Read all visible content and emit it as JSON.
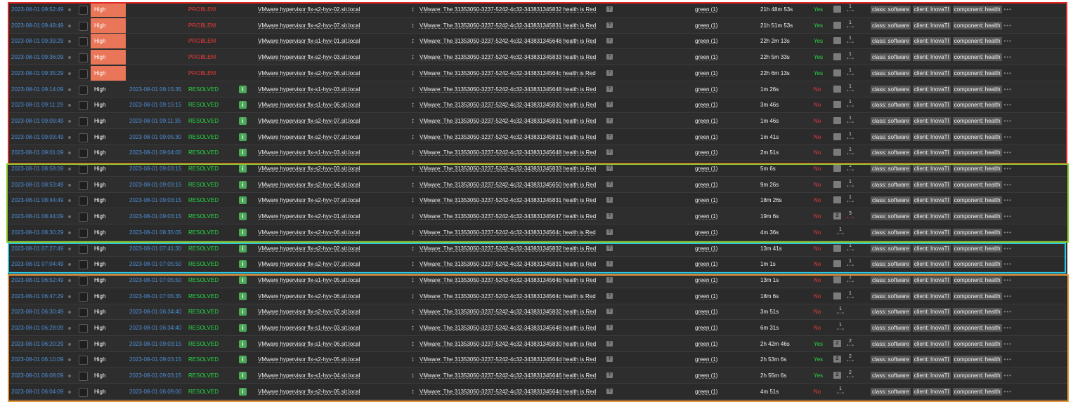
{
  "colors": {
    "accent_red": "#e32624",
    "accent_green": "#8ecb2f",
    "accent_cyan": "#2ec5df",
    "accent_orange": "#e8963c",
    "status_problem": "#e83b3b",
    "status_resolved": "#28d645",
    "severity_high": "#e97659",
    "link_blue": "#4f8fd6"
  },
  "tag_more": "•••",
  "rows": [
    {
      "time": "2023-08-01 09:52:49",
      "severity": "High",
      "sev_highlight": true,
      "recovery_time": "",
      "status": "PROBLEM",
      "status_type": "problem",
      "show_info": false,
      "host": "VMware hypervisor flx-s2-hyv-02.sit.local",
      "problem": "VMware: The 31353050-3237-5242-4c32-343831345832 health is Red",
      "op_data": "green (1)",
      "duration": "21h 48m 53s",
      "ack": "Yes",
      "msg_count": "",
      "actions_count": "1",
      "actions_red": false,
      "tags": [
        "class: software",
        "client: InovaTI",
        "component: health"
      ]
    },
    {
      "time": "2023-08-01 09:49:49",
      "severity": "High",
      "sev_highlight": true,
      "recovery_time": "",
      "status": "PROBLEM",
      "status_type": "problem",
      "show_info": false,
      "host": "VMware hypervisor flx-s2-hyv-07.sit.local",
      "problem": "VMware: The 31353050-3237-5242-4c32-343831345831 health is Red",
      "op_data": "green (1)",
      "duration": "21h 51m 53s",
      "ack": "Yes",
      "msg_count": "",
      "actions_count": "1",
      "actions_red": false,
      "tags": [
        "class: software",
        "client: InovaTI",
        "component: health"
      ]
    },
    {
      "time": "2023-08-01 09:39:29",
      "severity": "High",
      "sev_highlight": true,
      "recovery_time": "",
      "status": "PROBLEM",
      "status_type": "problem",
      "show_info": false,
      "host": "VMware hypervisor flx-s1-hyv-01.sit.local",
      "problem": "VMware: The 31353050-3237-5242-4c32-343831345648 health is Red",
      "op_data": "green (1)",
      "duration": "22h 2m 13s",
      "ack": "Yes",
      "msg_count": "",
      "actions_count": "1",
      "actions_red": false,
      "tags": [
        "class: software",
        "client: InovaTI",
        "component: health"
      ]
    },
    {
      "time": "2023-08-01 09:36:09",
      "severity": "High",
      "sev_highlight": true,
      "recovery_time": "",
      "status": "PROBLEM",
      "status_type": "problem",
      "show_info": false,
      "host": "VMware hypervisor flx-s2-hyv-03.sit.local",
      "problem": "VMware: The 31353050-3237-5242-4c32-343831345833 health is Red",
      "op_data": "green (1)",
      "duration": "22h 5m 33s",
      "ack": "Yes",
      "msg_count": "",
      "actions_count": "1",
      "actions_red": false,
      "tags": [
        "class: software",
        "client: InovaTI",
        "component: health"
      ]
    },
    {
      "time": "2023-08-01 09:35:29",
      "severity": "High",
      "sev_highlight": true,
      "recovery_time": "",
      "status": "PROBLEM",
      "status_type": "problem",
      "show_info": false,
      "host": "VMware hypervisor flx-s2-hyv-06.sit.local",
      "problem": "VMware: The 31353050-3237-5242-4c32-34383134564c health is Red",
      "op_data": "green (1)",
      "duration": "22h 6m 13s",
      "ack": "Yes",
      "msg_count": "",
      "actions_count": "1",
      "actions_red": false,
      "tags": [
        "class: software",
        "client: InovaTI",
        "component: health"
      ]
    },
    {
      "time": "2023-08-01 09:14:09",
      "severity": "High",
      "sev_highlight": false,
      "recovery_time": "2023-08-01 09:15:35",
      "status": "RESOLVED",
      "status_type": "resolved",
      "show_info": true,
      "host": "VMware hypervisor flx-s1-hyv-03.sit.local",
      "problem": "VMware: The 31353050-3237-5242-4c32-343831345648 health is Red",
      "op_data": "green (1)",
      "duration": "1m 26s",
      "ack": "No",
      "msg_count": "",
      "actions_count": "1",
      "actions_red": false,
      "tags": [
        "class: software",
        "client: InovaTI",
        "component: health"
      ]
    },
    {
      "time": "2023-08-01 09:11:29",
      "severity": "High",
      "sev_highlight": false,
      "recovery_time": "2023-08-01 09:15:15",
      "status": "RESOLVED",
      "status_type": "resolved",
      "show_info": true,
      "host": "VMware hypervisor flx-s1-hyv-06.sit.local",
      "problem": "VMware: The 31353050-3237-5242-4c32-343831345830 health is Red",
      "op_data": "green (1)",
      "duration": "3m 46s",
      "ack": "No",
      "msg_count": "",
      "actions_count": "1",
      "actions_red": false,
      "tags": [
        "class: software",
        "client: InovaTI",
        "component: health"
      ]
    },
    {
      "time": "2023-08-01 09:09:49",
      "severity": "High",
      "sev_highlight": false,
      "recovery_time": "2023-08-01 09:11:35",
      "status": "RESOLVED",
      "status_type": "resolved",
      "show_info": true,
      "host": "VMware hypervisor flx-s2-hyv-07.sit.local",
      "problem": "VMware: The 31353050-3237-5242-4c32-343831345831 health is Red",
      "op_data": "green (1)",
      "duration": "1m 46s",
      "ack": "No",
      "msg_count": "",
      "actions_count": "1",
      "actions_red": false,
      "tags": [
        "class: software",
        "client: InovaTI",
        "component: health"
      ]
    },
    {
      "time": "2023-08-01 09:03:49",
      "severity": "High",
      "sev_highlight": false,
      "recovery_time": "2023-08-01 09:05:30",
      "status": "RESOLVED",
      "status_type": "resolved",
      "show_info": true,
      "host": "VMware hypervisor flx-s2-hyv-07.sit.local",
      "problem": "VMware: The 31353050-3237-5242-4c32-343831345831 health is Red",
      "op_data": "green (1)",
      "duration": "1m 41s",
      "ack": "No",
      "msg_count": "",
      "actions_count": "1",
      "actions_red": false,
      "tags": [
        "class: software",
        "client: InovaTI",
        "component: health"
      ]
    },
    {
      "time": "2023-08-01 09:01:09",
      "severity": "High",
      "sev_highlight": false,
      "recovery_time": "2023-08-01 09:04:00",
      "status": "RESOLVED",
      "status_type": "resolved",
      "show_info": true,
      "host": "VMware hypervisor flx-s1-hyv-03.sit.local",
      "problem": "VMware: The 31353050-3237-5242-4c32-343831345648 health is Red",
      "op_data": "green (1)",
      "duration": "2m 51s",
      "ack": "No",
      "msg_count": "",
      "actions_count": "1",
      "actions_red": false,
      "tags": [
        "class: software",
        "client: InovaTI",
        "component: health"
      ]
    },
    {
      "time": "2023-08-01 08:58:09",
      "severity": "High",
      "sev_highlight": false,
      "recovery_time": "2023-08-01 09:03:15",
      "status": "RESOLVED",
      "status_type": "resolved",
      "show_info": true,
      "host": "VMware hypervisor flx-s2-hyv-03.sit.local",
      "problem": "VMware: The 31353050-3237-5242-4c32-343831345833 health is Red",
      "op_data": "green (1)",
      "duration": "5m 6s",
      "ack": "No",
      "msg_count": "",
      "actions_count": "1",
      "actions_red": false,
      "tags": [
        "class: software",
        "client: InovaTI",
        "component: health"
      ]
    },
    {
      "time": "2023-08-01 08:53:49",
      "severity": "High",
      "sev_highlight": false,
      "recovery_time": "2023-08-01 09:03:15",
      "status": "RESOLVED",
      "status_type": "resolved",
      "show_info": true,
      "host": "VMware hypervisor flx-s2-hyv-04.sit.local",
      "problem": "VMware: The 31353050-3237-5242-4c32-343831345650 health is Red",
      "op_data": "green (1)",
      "duration": "9m 26s",
      "ack": "No",
      "msg_count": "",
      "actions_count": "1",
      "actions_red": false,
      "tags": [
        "class: software",
        "client: InovaTI",
        "component: health"
      ]
    },
    {
      "time": "2023-08-01 08:44:49",
      "severity": "High",
      "sev_highlight": false,
      "recovery_time": "2023-08-01 09:03:15",
      "status": "RESOLVED",
      "status_type": "resolved",
      "show_info": true,
      "host": "VMware hypervisor flx-s2-hyv-07.sit.local",
      "problem": "VMware: The 31353050-3237-5242-4c32-343831345831 health is Red",
      "op_data": "green (1)",
      "duration": "18m 26s",
      "ack": "No",
      "msg_count": "",
      "actions_count": "1",
      "actions_red": false,
      "tags": [
        "class: software",
        "client: InovaTI",
        "component: health"
      ]
    },
    {
      "time": "2023-08-01 08:44:09",
      "severity": "High",
      "sev_highlight": false,
      "recovery_time": "2023-08-01 09:03:15",
      "status": "RESOLVED",
      "status_type": "resolved",
      "show_info": true,
      "host": "VMware hypervisor flx-s2-hyv-01.sit.local",
      "problem": "VMware: The 31353050-3237-5242-4c32-343831345647 health is Red",
      "op_data": "green (1)",
      "duration": "19m 6s",
      "ack": "No",
      "msg_count": "2",
      "actions_count": "3",
      "actions_red": true,
      "tags": [
        "class: software",
        "client: InovaTI",
        "component: health"
      ]
    },
    {
      "time": "2023-08-01 08:30:29",
      "severity": "High",
      "sev_highlight": false,
      "recovery_time": "2023-08-01 08:35:05",
      "status": "RESOLVED",
      "status_type": "resolved",
      "show_info": true,
      "host": "VMware hypervisor flx-s2-hyv-06.sit.local",
      "problem": "VMware: The 31353050-3237-5242-4c32-34383134564c health is Red",
      "op_data": "green (1)",
      "duration": "4m 36s",
      "ack": "No",
      "msg_count": "",
      "actions_count": "1",
      "actions_red": false,
      "no_msg_icon": true,
      "tags": [
        "class: software",
        "client: InovaTI",
        "component: health"
      ]
    },
    {
      "time": "2023-08-01 07:27:49",
      "severity": "High",
      "sev_highlight": false,
      "recovery_time": "2023-08-01 07:41:30",
      "status": "RESOLVED",
      "status_type": "resolved",
      "show_info": true,
      "host": "VMware hypervisor flx-s2-hyv-02.sit.local",
      "problem": "VMware: The 31353050-3237-5242-4c32-343831345832 health is Red",
      "op_data": "green (1)",
      "duration": "13m 41s",
      "ack": "No",
      "msg_count": "",
      "actions_count": "1",
      "actions_red": false,
      "tags": [
        "class: software",
        "client: InovaTI",
        "component: health"
      ]
    },
    {
      "time": "2023-08-01 07:04:49",
      "severity": "High",
      "sev_highlight": false,
      "recovery_time": "2023-08-01 07:05:50",
      "status": "RESOLVED",
      "status_type": "resolved",
      "show_info": true,
      "host": "VMware hypervisor flx-s2-hyv-07.sit.local",
      "problem": "VMware: The 31353050-3237-5242-4c32-343831345831 health is Red",
      "op_data": "green (1)",
      "duration": "1m 1s",
      "ack": "No",
      "msg_count": "",
      "actions_count": "1",
      "actions_red": false,
      "tags": [
        "class: software",
        "client: InovaTI",
        "component: health"
      ]
    },
    {
      "time": "2023-08-01 06:52:49",
      "severity": "High",
      "sev_highlight": false,
      "recovery_time": "2023-08-01 07:05:50",
      "status": "RESOLVED",
      "status_type": "resolved",
      "show_info": true,
      "host": "VMware hypervisor flx-s1-hyv-05.sit.local",
      "problem": "VMware: The 31353050-3237-5242-4c32-34383134564b health is Red",
      "op_data": "green (1)",
      "duration": "13m 1s",
      "ack": "No",
      "msg_count": "",
      "actions_count": "1",
      "actions_red": false,
      "tags": [
        "class: software",
        "client: InovaTI",
        "component: health"
      ]
    },
    {
      "time": "2023-08-01 06:47:29",
      "severity": "High",
      "sev_highlight": false,
      "recovery_time": "2023-08-01 07:05:35",
      "status": "RESOLVED",
      "status_type": "resolved",
      "show_info": true,
      "host": "VMware hypervisor flx-s2-hyv-06.sit.local",
      "problem": "VMware: The 31353050-3237-5242-4c32-34383134564c health is Red",
      "op_data": "green (1)",
      "duration": "18m 6s",
      "ack": "No",
      "msg_count": "",
      "actions_count": "1",
      "actions_red": false,
      "tags": [
        "class: software",
        "client: InovaTI",
        "component: health"
      ]
    },
    {
      "time": "2023-08-01 06:30:49",
      "severity": "High",
      "sev_highlight": false,
      "recovery_time": "2023-08-01 06:34:40",
      "status": "RESOLVED",
      "status_type": "resolved",
      "show_info": true,
      "host": "VMware hypervisor flx-s2-hyv-02.sit.local",
      "problem": "VMware: The 31353050-3237-5242-4c32-343831345832 health is Red",
      "op_data": "green (1)",
      "duration": "3m 51s",
      "ack": "No",
      "msg_count": "",
      "actions_count": "1",
      "actions_red": false,
      "no_msg_icon": true,
      "tags": [
        "class: software",
        "client: InovaTI",
        "component: health"
      ]
    },
    {
      "time": "2023-08-01 06:28:09",
      "severity": "High",
      "sev_highlight": false,
      "recovery_time": "2023-08-01 06:34:40",
      "status": "RESOLVED",
      "status_type": "resolved",
      "show_info": true,
      "host": "VMware hypervisor flx-s1-hyv-03.sit.local",
      "problem": "VMware: The 31353050-3237-5242-4c32-343831345648 health is Red",
      "op_data": "green (1)",
      "duration": "6m 31s",
      "ack": "No",
      "msg_count": "",
      "actions_count": "1",
      "actions_red": false,
      "no_msg_icon": true,
      "tags": [
        "class: software",
        "client: InovaTI",
        "component: health"
      ]
    },
    {
      "time": "2023-08-01 06:20:29",
      "severity": "High",
      "sev_highlight": false,
      "recovery_time": "2023-08-01 09:03:15",
      "status": "RESOLVED",
      "status_type": "resolved",
      "show_info": true,
      "host": "VMware hypervisor flx-s1-hyv-06.sit.local",
      "problem": "VMware: The 31353050-3237-5242-4c32-343831345830 health is Red",
      "op_data": "green (1)",
      "duration": "2h 42m 46s",
      "ack": "Yes",
      "msg_count": "2",
      "actions_count": "2",
      "actions_red": false,
      "tags": [
        "class: software",
        "client: InovaTI",
        "component: health"
      ]
    },
    {
      "time": "2023-08-01 06:10:09",
      "severity": "High",
      "sev_highlight": false,
      "recovery_time": "2023-08-01 09:03:15",
      "status": "RESOLVED",
      "status_type": "resolved",
      "show_info": true,
      "host": "VMware hypervisor flx-s2-hyv-05.sit.local",
      "problem": "VMware: The 31353050-3237-5242-4c32-34383134564d health is Red",
      "op_data": "green (1)",
      "duration": "2h 53m 6s",
      "ack": "Yes",
      "msg_count": "2",
      "actions_count": "2",
      "actions_red": false,
      "tags": [
        "class: software",
        "client: InovaTI",
        "component: health"
      ]
    },
    {
      "time": "2023-08-01 06:08:09",
      "severity": "High",
      "sev_highlight": false,
      "recovery_time": "2023-08-01 09:03:15",
      "status": "RESOLVED",
      "status_type": "resolved",
      "show_info": true,
      "host": "VMware hypervisor flx-s1-hyv-04.sit.local",
      "problem": "VMware: The 31353050-3237-5242-4c32-343831345646 health is Red",
      "op_data": "green (1)",
      "duration": "2h 55m 6s",
      "ack": "Yes",
      "msg_count": "2",
      "actions_count": "2",
      "actions_red": false,
      "tags": [
        "class: software",
        "client: InovaTI",
        "component: health"
      ]
    },
    {
      "time": "2023-08-01 06:04:09",
      "severity": "High",
      "sev_highlight": false,
      "recovery_time": "2023-08-01 06:09:00",
      "status": "RESOLVED",
      "status_type": "resolved",
      "show_info": true,
      "host": "VMware hypervisor flx-s2-hyv-05.sit.local",
      "problem": "VMware: The 31353050-3237-5242-4c32-34383134564d health is Red",
      "op_data": "green (1)",
      "duration": "4m 51s",
      "ack": "No",
      "msg_count": "",
      "actions_count": "1",
      "actions_red": false,
      "no_msg_icon": true,
      "tags": [
        "class: software",
        "client: InovaTI",
        "component: health"
      ]
    }
  ]
}
